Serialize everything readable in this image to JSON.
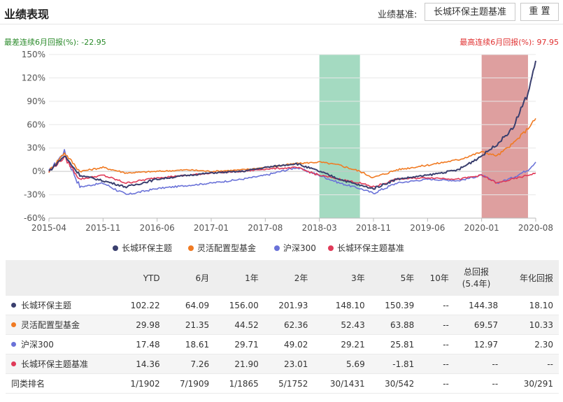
{
  "header": {
    "title": "业绩表现",
    "benchmark_label": "业绩基准:",
    "benchmark_value": "长城环保主题基准",
    "reset_label": "重 置"
  },
  "annotations": {
    "worst_label": "最差连续6月回报(%): -22.95",
    "best_label": "最高连续6月回报(%): 97.95"
  },
  "colors": {
    "fund": "#3a3f6e",
    "flex": "#f07a22",
    "hs300": "#6a72d8",
    "bench": "#e03a58",
    "green_band": "#9fd8be",
    "red_band": "#dc9a9a"
  },
  "chart_data": {
    "type": "line",
    "y_ticks": [
      "150%",
      "120%",
      "90%",
      "60%",
      "30%",
      "0%",
      "-30%",
      "-60%"
    ],
    "x_ticks": [
      "2015-04",
      "2015-11",
      "2016-06",
      "2017-01",
      "2017-08",
      "2018-03",
      "2018-11",
      "2019-06",
      "2020-01",
      "2020-08"
    ],
    "ylim": [
      -60,
      150
    ],
    "highlight_ranges": [
      {
        "from": "2018-03",
        "to": "2018-09",
        "kind": "worst"
      },
      {
        "from": "2020-01",
        "to": "2020-07",
        "kind": "best"
      }
    ],
    "x": [
      "2015-04",
      "2015-06",
      "2015-08",
      "2015-11",
      "2016-02",
      "2016-06",
      "2016-10",
      "2017-01",
      "2017-05",
      "2017-08",
      "2017-12",
      "2018-03",
      "2018-06",
      "2018-09",
      "2018-11",
      "2019-02",
      "2019-06",
      "2019-10",
      "2020-01",
      "2020-03",
      "2020-05",
      "2020-07",
      "2020-08"
    ],
    "series": [
      {
        "name": "长城环保主题",
        "key": "fund",
        "values": [
          0,
          20,
          -5,
          -12,
          -20,
          -10,
          -5,
          -2,
          0,
          5,
          10,
          0,
          -10,
          -18,
          -22,
          -10,
          -5,
          2,
          20,
          35,
          55,
          100,
          142
        ]
      },
      {
        "name": "灵活配置型基金",
        "key": "flex",
        "values": [
          0,
          24,
          0,
          5,
          -2,
          0,
          2,
          0,
          2,
          5,
          10,
          12,
          8,
          0,
          -8,
          2,
          8,
          15,
          25,
          20,
          35,
          55,
          68
        ]
      },
      {
        "name": "沪深300",
        "key": "hs300",
        "values": [
          0,
          25,
          -20,
          -15,
          -30,
          -22,
          -18,
          -15,
          -10,
          -5,
          5,
          -5,
          -15,
          -22,
          -28,
          -15,
          -10,
          -12,
          -5,
          -15,
          -8,
          2,
          12
        ]
      },
      {
        "name": "长城环保主题基准",
        "key": "bench",
        "values": [
          0,
          18,
          -10,
          -5,
          -15,
          -8,
          -5,
          -2,
          0,
          3,
          5,
          -5,
          -10,
          -15,
          -20,
          -10,
          -8,
          -10,
          -5,
          -15,
          -10,
          -5,
          -2
        ]
      }
    ]
  },
  "legend": [
    {
      "label": "长城环保主题",
      "key": "fund"
    },
    {
      "label": "灵活配置型基金",
      "key": "flex"
    },
    {
      "label": "沪深300",
      "key": "hs300"
    },
    {
      "label": "长城环保主题基准",
      "key": "bench"
    }
  ],
  "table": {
    "headers": [
      "",
      "YTD",
      "6月",
      "1年",
      "2年",
      "3年",
      "5年",
      "10年",
      "总回报",
      "(5.4年)",
      "年化回报"
    ],
    "rows": [
      {
        "name": "长城环保主题",
        "key": "fund",
        "cells": [
          "102.22",
          "64.09",
          "156.00",
          "201.93",
          "148.10",
          "150.39",
          "--",
          "144.38",
          "18.10"
        ]
      },
      {
        "name": "灵活配置型基金",
        "key": "flex",
        "cells": [
          "29.98",
          "21.35",
          "44.52",
          "62.36",
          "52.43",
          "63.88",
          "--",
          "69.57",
          "10.33"
        ]
      },
      {
        "name": "沪深300",
        "key": "hs300",
        "cells": [
          "17.48",
          "18.61",
          "29.71",
          "49.02",
          "29.21",
          "25.81",
          "--",
          "12.97",
          "2.30"
        ]
      },
      {
        "name": "长城环保主题基准",
        "key": "bench",
        "cells": [
          "14.36",
          "7.26",
          "21.90",
          "23.01",
          "5.69",
          "-1.81",
          "--",
          "--",
          "--"
        ]
      },
      {
        "name": "同类排名",
        "key": "",
        "cells": [
          "1/1902",
          "7/1909",
          "1/1865",
          "5/1752",
          "30/1431",
          "30/542",
          "--",
          "--",
          "30/291"
        ]
      }
    ]
  }
}
